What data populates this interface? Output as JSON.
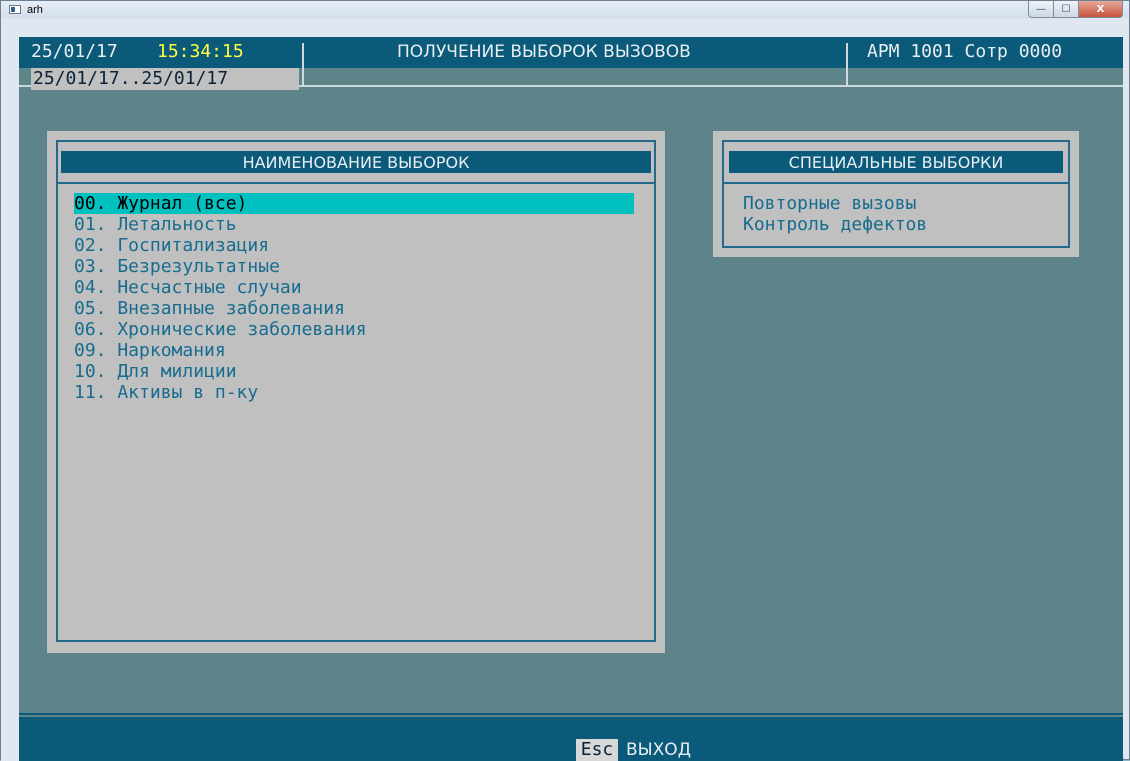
{
  "window": {
    "title": "arh",
    "min_glyph": "—",
    "max_glyph": "☐",
    "close_glyph": "X"
  },
  "header": {
    "date": "25/01/17",
    "time": "15:34:15",
    "title": "ПОЛУЧЕНИЕ ВЫБОРОК ВЫЗОВОВ",
    "station": "АРМ 1001 Сотр 0000",
    "range": "25/01/17..25/01/17"
  },
  "main_panel": {
    "heading": "НАИМЕНОВАНИЕ ВЫБОРОК",
    "items": [
      "00. Журнал (все)",
      "01. Летальность",
      "02. Госпитализация",
      "03. Безрезультатные",
      "04. Несчастные случаи",
      "05. Внезапные заболевания",
      "06. Хронические заболевания",
      "09. Наркомания",
      "10. Для милиции",
      "11. Активы в п-ку"
    ],
    "selected_index": 0
  },
  "special_panel": {
    "heading": "СПЕЦИАЛЬНЫЕ ВЫБОРКИ",
    "items": [
      "Повторные вызовы",
      "Контроль дефектов"
    ]
  },
  "footer": {
    "key": "Esc",
    "label": "ВЫХОД"
  },
  "colors": {
    "screen_bg": "#5d8489",
    "bar_blue": "#0b5a7a",
    "panel_gray": "#c0c0c0",
    "item_text": "#166c8f",
    "highlight": "#00c0c0",
    "time_yellow": "#ffff40"
  },
  "icons": [
    "app-icon",
    "minimize-icon",
    "maximize-icon",
    "close-icon"
  ]
}
